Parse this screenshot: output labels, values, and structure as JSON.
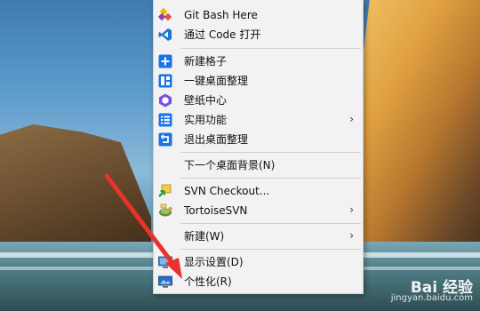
{
  "context_menu": {
    "items": [
      {
        "label": "Git Bash Here",
        "icon": "git-bash-icon",
        "submenu": false
      },
      {
        "label": "通过 Code 打开",
        "icon": "vscode-icon",
        "submenu": false
      },
      {
        "label": "新建格子",
        "icon": "plus-box-icon",
        "submenu": false
      },
      {
        "label": "一键桌面整理",
        "icon": "organize-icon",
        "submenu": false
      },
      {
        "label": "壁纸中心",
        "icon": "wallpaper-icon",
        "submenu": false
      },
      {
        "label": "实用功能",
        "icon": "list-icon",
        "submenu": true
      },
      {
        "label": "退出桌面整理",
        "icon": "exit-icon",
        "submenu": false
      },
      {
        "label": "下一个桌面背景(N)",
        "icon": "",
        "submenu": false
      },
      {
        "label": "SVN Checkout...",
        "icon": "svn-checkout-icon",
        "submenu": false
      },
      {
        "label": "TortoiseSVN",
        "icon": "tortoisesvn-icon",
        "submenu": true
      },
      {
        "label": "新建(W)",
        "icon": "",
        "submenu": true
      },
      {
        "label": "显示设置(D)",
        "icon": "display-settings-icon",
        "submenu": false
      },
      {
        "label": "个性化(R)",
        "icon": "personalize-icon",
        "submenu": false
      }
    ],
    "submenu_arrow": "›"
  },
  "watermark": {
    "logo": "Bai 经验",
    "url": "jingyan.baidu.com"
  },
  "colors": {
    "menu_bg": "#f2f2f2",
    "accent_blue": "#1a73e8",
    "arrow_red": "#e8322b"
  }
}
